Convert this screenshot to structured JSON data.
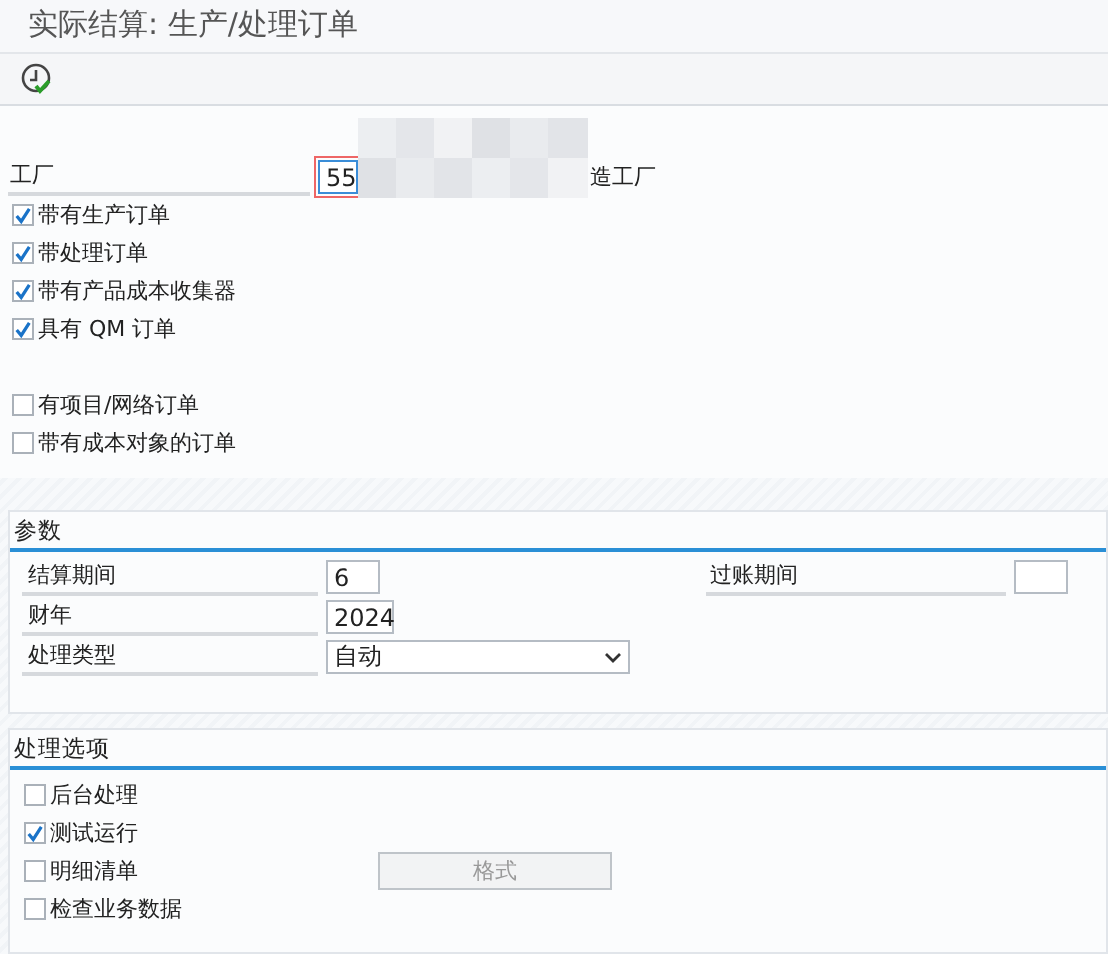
{
  "window": {
    "title": "实际结算: 生产/处理订单"
  },
  "toolbar": {
    "buttons": [
      {
        "kind": "execute"
      }
    ]
  },
  "plant": {
    "label": "工厂",
    "value": "55",
    "description": "造工厂"
  },
  "order_types": [
    {
      "label": "带有生产订单",
      "checked": true
    },
    {
      "label": "带处理订单",
      "checked": true
    },
    {
      "label": "带有产品成本收集器",
      "checked": true
    },
    {
      "label": "具有 QM 订单",
      "checked": true
    }
  ],
  "other_orders": [
    {
      "label": "有项目/网络订单",
      "checked": false
    },
    {
      "label": "带有成本对象的订单",
      "checked": false
    }
  ],
  "parameters": {
    "title": "参数",
    "settlement_period": {
      "label": "结算期间",
      "value": "6"
    },
    "posting_period": {
      "label": "过账期间"
    },
    "fiscal_year": {
      "label": "财年",
      "value": "2024"
    },
    "processing_type": {
      "label": "处理类型",
      "value": "自动"
    }
  },
  "processing_options": {
    "title": "处理选项",
    "items": [
      {
        "label": "后台处理",
        "checked": false
      },
      {
        "label": "测试运行",
        "checked": true
      },
      {
        "label": "明细清单",
        "checked": false
      },
      {
        "label": "检查业务数据",
        "checked": false
      }
    ],
    "layout_button": {
      "label": "格式",
      "disabled": true
    }
  }
}
